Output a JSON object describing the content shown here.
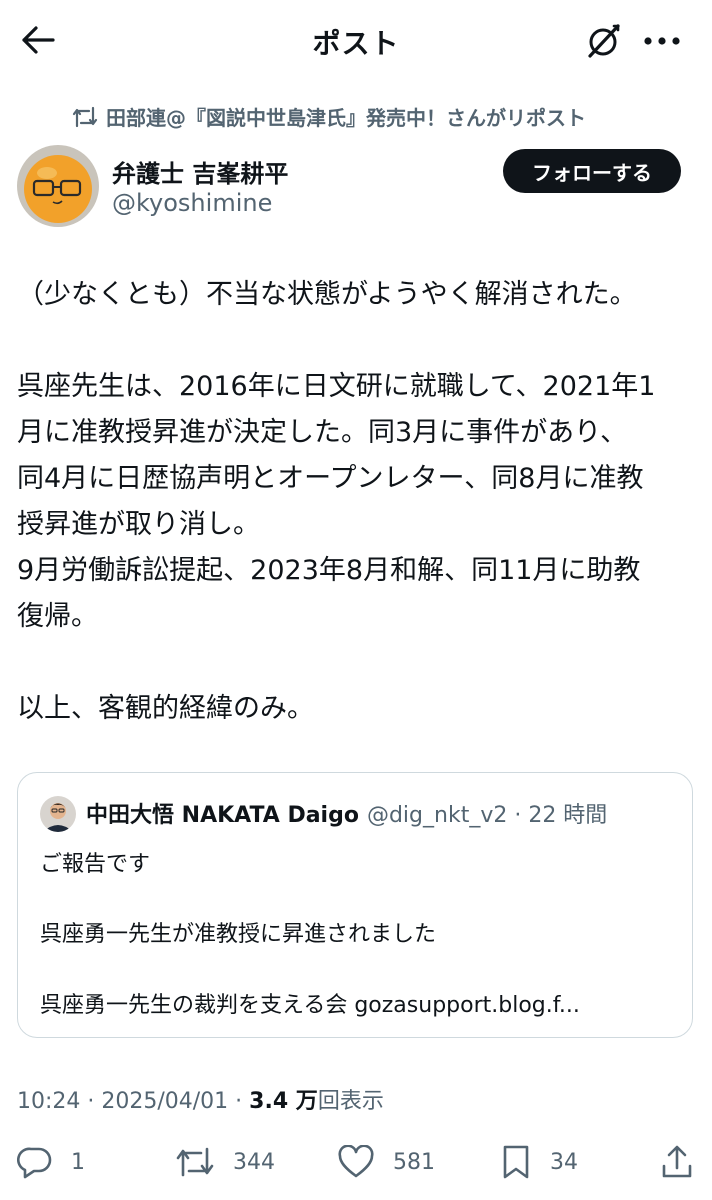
{
  "header": {
    "title": "ポスト"
  },
  "repost": {
    "text": "田部連@『図説中世島津氏』発売中！さんがリポスト"
  },
  "author": {
    "display_name": "弁護士 吉峯耕平",
    "handle": "@kyoshimine",
    "follow_label": "フォローする"
  },
  "post": {
    "paragraphs": [
      [
        "（少なくとも）不当な状態がようやく解消された。"
      ],
      [
        "呉座先生は、2016年に日文研に就職して、2021年1",
        "月に准教授昇進が決定した。同3月に事件があり、",
        "同4月に日歴協声明とオープンレター、同8月に准教",
        "授昇進が取り消し。",
        "9月労働訴訟提起、2023年8月和解、同11月に助教",
        "復帰。"
      ],
      [
        "以上、客観的経緯のみ。"
      ]
    ]
  },
  "quote": {
    "name": "中田大悟 NAKATA Daigo",
    "meta": "@dig_nkt_v2 · 22 時間",
    "lines": [
      "ご報告です",
      "呉座勇一先生が准教授に昇進されました",
      "呉座勇一先生の裁判を支える会 gozasupport.blog.f..."
    ]
  },
  "meta": {
    "time": "10:24 · 2025/04/01 · ",
    "views_count": "3.4 万",
    "views_label": "回表示"
  },
  "actions": {
    "replies": "1",
    "reposts": "344",
    "likes": "581",
    "bookmarks": "34"
  },
  "colors": {
    "text": "#0f1419",
    "secondary": "#536471",
    "border": "#cfd9de",
    "follow_bg": "#0f1419"
  }
}
